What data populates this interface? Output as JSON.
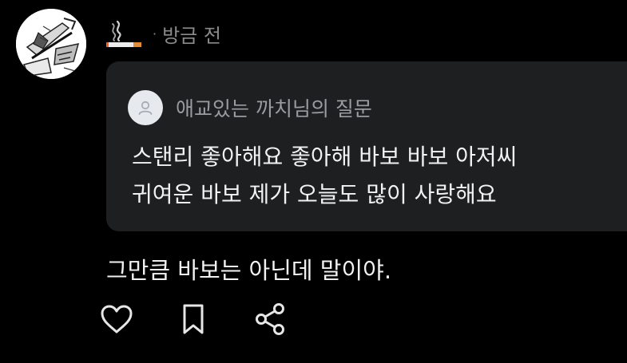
{
  "post": {
    "author_icon": "cigarette-emoji",
    "separator": "·",
    "timestamp": "방금 전"
  },
  "question": {
    "asker_name": "애교있는 까치님의 질문",
    "text": "스탠리 좋아해요 좋아해 바보 바보 아저씨\n귀여운 바보 제가 오늘도 많이 사랑해요"
  },
  "answer": {
    "text": "그만큼 바보는 아닌데 말이야."
  },
  "actions": {
    "icons": [
      "heart-icon",
      "bookmark-icon",
      "share-icon"
    ]
  },
  "colors": {
    "background": "#000000",
    "card": "#1e1f21",
    "muted_text": "#8a8a8a",
    "primary_text": "#f2f2f2"
  }
}
